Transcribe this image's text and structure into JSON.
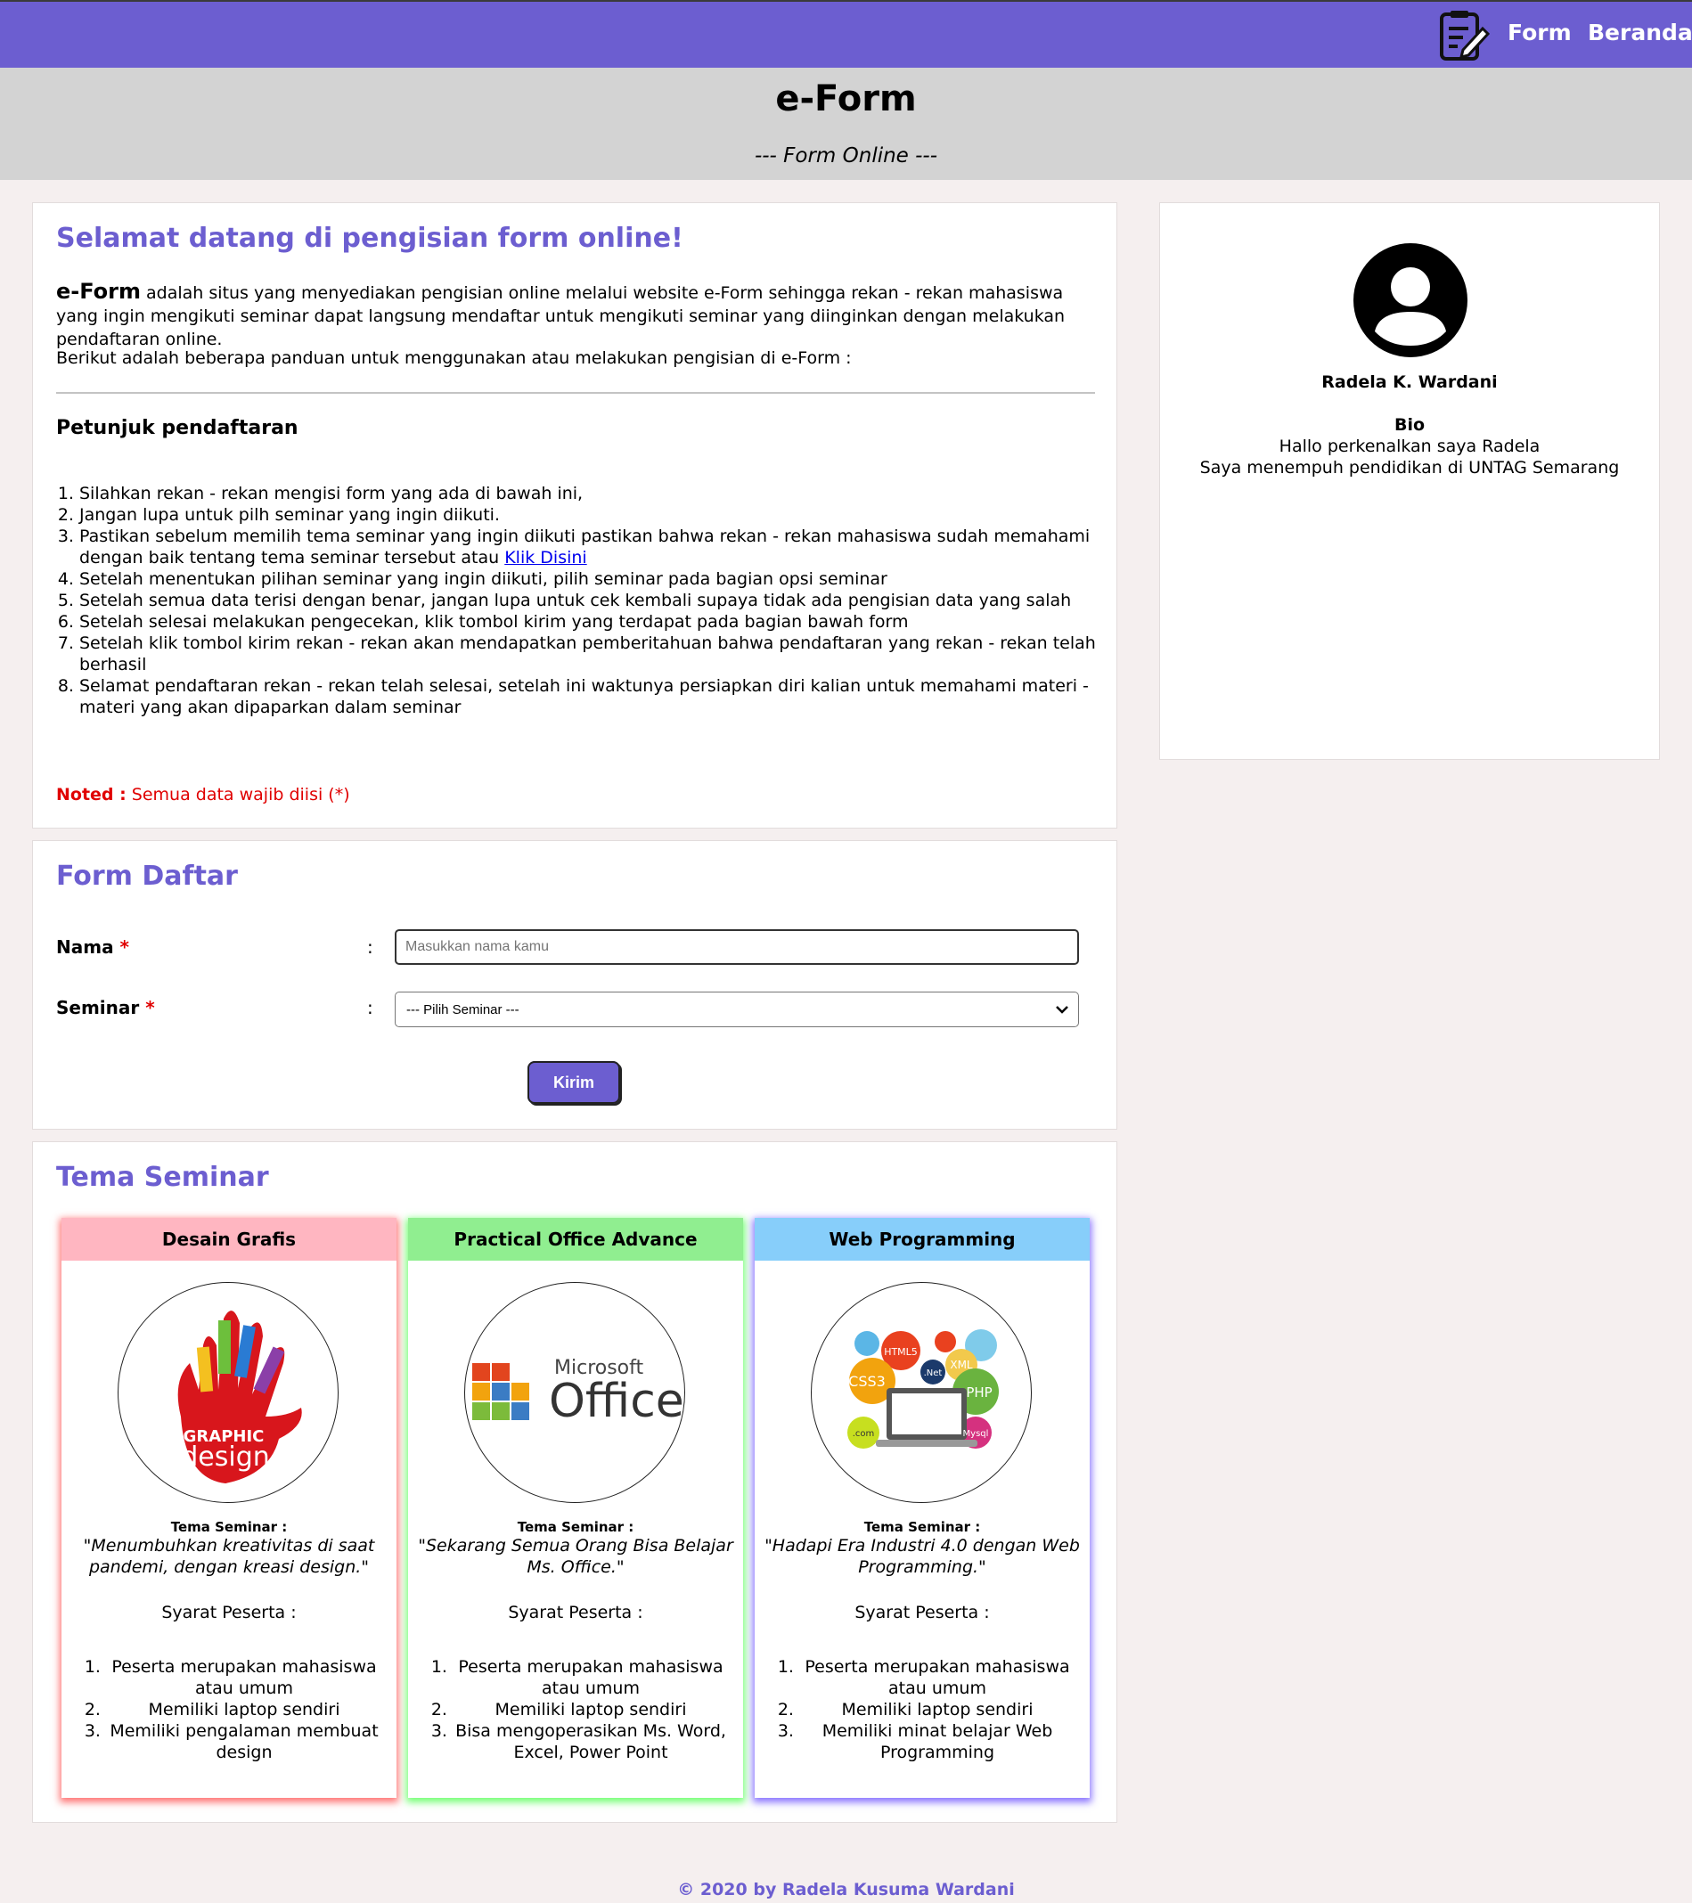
{
  "navbar": {
    "logo_icon": "edit-document-icon",
    "links": [
      "Form",
      "Beranda"
    ],
    "bg_color": "#6c5ed0"
  },
  "header": {
    "title": "e-Form",
    "subtitle": "--- Form Online ---"
  },
  "intro": {
    "heading": "Selamat datang di pengisian form online!",
    "brand": "e-Form",
    "paragraph": " adalah situs yang menyediakan pengisian online melalui website e-Form sehingga rekan - rekan mahasiswa yang ingin mengikuti seminar dapat langsung mendaftar untuk mengikuti seminar yang diinginkan dengan melakukan pendaftaran online.",
    "guide_text": "Berikut adalah beberapa panduan untuk menggunakan atau melakukan pengisian di e-Form :",
    "steps_heading": "Petunjuk pendaftaran",
    "steps": [
      "Silahkan rekan - rekan mengisi form yang ada di bawah ini,",
      "Jangan lupa untuk pilh seminar yang ingin diikuti.",
      "Pastikan sebelum memilih tema seminar yang ingin diikuti pastikan bahwa rekan - rekan mahasiswa sudah memahami dengan baik tentang tema seminar tersebut atau ",
      "Setelah menentukan pilihan seminar yang ingin diikuti, pilih seminar pada bagian opsi seminar",
      "Setelah semua data terisi dengan benar, jangan lupa untuk cek kembali supaya tidak ada pengisian data yang salah",
      "Setelah selesai melakukan pengecekan, klik tombol kirim yang terdapat pada bagian bawah form",
      "Setelah klik tombol kirim rekan - rekan akan mendapatkan pemberitahuan bahwa pendaftaran yang rekan - rekan telah berhasil",
      "Selamat pendaftaran rekan - rekan telah selesai, setelah ini waktunya persiapkan diri kalian untuk memahami materi - materi yang akan dipaparkan dalam seminar"
    ],
    "link_text": "Klik Disini",
    "noted_label": "Noted :",
    "noted_text": " Semua data wajib diisi (*)"
  },
  "form": {
    "heading": "Form Daftar",
    "nama_label": "Nama",
    "seminar_label": "Seminar",
    "required_mark": "*",
    "colon": ":",
    "nama_placeholder": "Masukkan nama kamu",
    "seminar_selected": "--- Pilih Seminar ---",
    "submit_label": "Kirim"
  },
  "tema": {
    "heading": "Tema Seminar",
    "tema_label": "Tema Seminar :",
    "syarat_label": "Syarat Peserta :",
    "cards": [
      {
        "title": "Desain Grafis",
        "image_text": [
          "GRAPHIC",
          "design"
        ],
        "quote": "\"Menumbuhkan kreativitas di saat pandemi, dengan kreasi design.\"",
        "requirements": [
          "Peserta merupakan mahasiswa atau umum",
          "Memiliki laptop sendiri",
          "Memiliki pengalaman membuat design"
        ]
      },
      {
        "title": "Practical Office Advance",
        "image_text": [
          "Microsoft",
          "Office"
        ],
        "quote": "\"Sekarang Semua Orang Bisa Belajar Ms. Office.\"",
        "requirements": [
          "Peserta merupakan mahasiswa atau umum",
          "Memiliki laptop sendiri",
          "Bisa mengoperasikan Ms. Word, Excel, Power Point"
        ]
      },
      {
        "title": "Web Programming",
        "image_text": [
          "HTML5",
          "CSS3",
          "PHP",
          "XML",
          ".Net",
          "Mysql",
          ".com"
        ],
        "quote": "\"Hadapi Era Industri 4.0 dengan Web Programming.\"",
        "requirements": [
          "Peserta merupakan mahasiswa atau umum",
          "Memiliki laptop sendiri",
          "Memiliki minat belajar Web Programming"
        ]
      }
    ]
  },
  "profile": {
    "avatar_icon": "account-circle-icon",
    "name": "Radela K. Wardani",
    "bio_title": "Bio",
    "bio_lines": [
      "Hallo perkenalkan saya Radela",
      "Saya menempuh pendidikan di UNTAG Semarang"
    ]
  },
  "footer": {
    "text": "© 2020 by Radela Kusuma Wardani"
  }
}
